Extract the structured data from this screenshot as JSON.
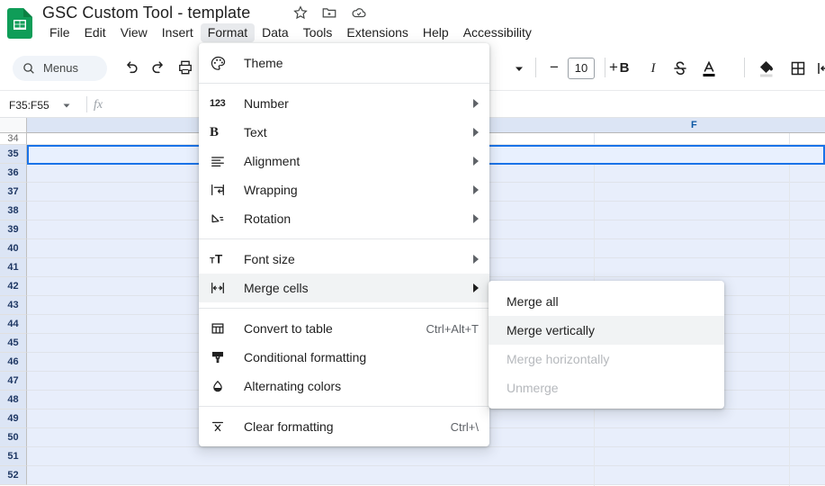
{
  "app": {
    "logo_icon": "google-sheets-logo",
    "doc_title": "GSC Custom Tool - template",
    "title_icons": [
      {
        "name": "star-icon",
        "label": "Star"
      },
      {
        "name": "move-to-folder-icon",
        "label": "Move"
      },
      {
        "name": "cloud-saved-icon",
        "label": "Saved to Drive"
      }
    ]
  },
  "menubar": {
    "items": [
      {
        "label": "File",
        "active": false
      },
      {
        "label": "Edit",
        "active": false
      },
      {
        "label": "View",
        "active": false
      },
      {
        "label": "Insert",
        "active": false
      },
      {
        "label": "Format",
        "active": true
      },
      {
        "label": "Data",
        "active": false
      },
      {
        "label": "Tools",
        "active": false
      },
      {
        "label": "Extensions",
        "active": false
      },
      {
        "label": "Help",
        "active": false
      },
      {
        "label": "Accessibility",
        "active": false
      }
    ]
  },
  "toolbar": {
    "search_label": "Menus",
    "search_icon": "search-icon",
    "undo_icon": "undo-icon",
    "redo_icon": "redo-icon",
    "print_icon": "print-icon",
    "paint_format_icon": "paint-format-icon",
    "zoom_caret_icon": "chevron-down-icon",
    "font_size_value": "10",
    "font_size_decrease": "−",
    "font_size_increase": "+",
    "bold_label": "B",
    "italic_label": "I",
    "strikethrough_icon": "strikethrough-icon",
    "text_color_icon": "text-color-icon",
    "fill_color_icon": "fill-color-icon",
    "borders_icon": "borders-icon",
    "merge_cells_icon": "merge-cells-icon"
  },
  "formulabar": {
    "name_box_value": "F35:F55",
    "name_box_caret": "chevron-down-icon",
    "fx_label": "fx",
    "formula_value": ""
  },
  "grid": {
    "column_header_label": "F",
    "rows": [
      {
        "num": "34",
        "selected": false
      },
      {
        "num": "35",
        "selected": true
      },
      {
        "num": "36",
        "selected": true
      },
      {
        "num": "37",
        "selected": true
      },
      {
        "num": "38",
        "selected": true
      },
      {
        "num": "39",
        "selected": true
      },
      {
        "num": "40",
        "selected": true
      },
      {
        "num": "41",
        "selected": true
      },
      {
        "num": "42",
        "selected": true
      },
      {
        "num": "43",
        "selected": true
      },
      {
        "num": "44",
        "selected": true
      },
      {
        "num": "45",
        "selected": true
      },
      {
        "num": "46",
        "selected": true
      },
      {
        "num": "47",
        "selected": true
      },
      {
        "num": "48",
        "selected": true
      },
      {
        "num": "49",
        "selected": true
      },
      {
        "num": "50",
        "selected": true
      },
      {
        "num": "51",
        "selected": true
      },
      {
        "num": "52",
        "selected": true
      }
    ]
  },
  "format_menu": {
    "groups": [
      {
        "items": [
          {
            "label": "Theme",
            "icon": "palette-icon",
            "shortcut": "",
            "submenu": false,
            "highlighted": false
          }
        ]
      },
      {
        "items": [
          {
            "label": "Number",
            "icon": "number-123-icon",
            "shortcut": "",
            "submenu": true,
            "highlighted": false
          },
          {
            "label": "Text",
            "icon": "text-bold-b-icon",
            "shortcut": "",
            "submenu": true,
            "highlighted": false
          },
          {
            "label": "Alignment",
            "icon": "alignment-icon",
            "shortcut": "",
            "submenu": true,
            "highlighted": false
          },
          {
            "label": "Wrapping",
            "icon": "text-wrap-icon",
            "shortcut": "",
            "submenu": true,
            "highlighted": false
          },
          {
            "label": "Rotation",
            "icon": "text-rotation-icon",
            "shortcut": "",
            "submenu": true,
            "highlighted": false
          }
        ]
      },
      {
        "items": [
          {
            "label": "Font size",
            "icon": "font-size-icon",
            "shortcut": "",
            "submenu": true,
            "highlighted": false
          },
          {
            "label": "Merge cells",
            "icon": "merge-cells-icon",
            "shortcut": "",
            "submenu": true,
            "highlighted": true
          }
        ]
      },
      {
        "items": [
          {
            "label": "Convert to table",
            "icon": "table-icon",
            "shortcut": "Ctrl+Alt+T",
            "submenu": false,
            "highlighted": false
          },
          {
            "label": "Conditional formatting",
            "icon": "format-paint-icon",
            "shortcut": "",
            "submenu": false,
            "highlighted": false
          },
          {
            "label": "Alternating colors",
            "icon": "water-drop-icon",
            "shortcut": "",
            "submenu": false,
            "highlighted": false
          }
        ]
      },
      {
        "items": [
          {
            "label": "Clear formatting",
            "icon": "clear-formatting-icon",
            "shortcut": "Ctrl+\\",
            "submenu": false,
            "highlighted": false
          }
        ]
      }
    ]
  },
  "merge_submenu": {
    "items": [
      {
        "label": "Merge all",
        "disabled": false,
        "highlighted": false
      },
      {
        "label": "Merge vertically",
        "disabled": false,
        "highlighted": true
      },
      {
        "label": "Merge horizontally",
        "disabled": true,
        "highlighted": false
      },
      {
        "label": "Unmerge",
        "disabled": true,
        "highlighted": false
      }
    ]
  },
  "colors": {
    "sheets_green": "#0f9d58",
    "selection_blue": "#1a73e8",
    "header_blue": "#dce5f5",
    "selection_fill": "#e8eefb",
    "menu_highlight": "#f1f3f4"
  }
}
